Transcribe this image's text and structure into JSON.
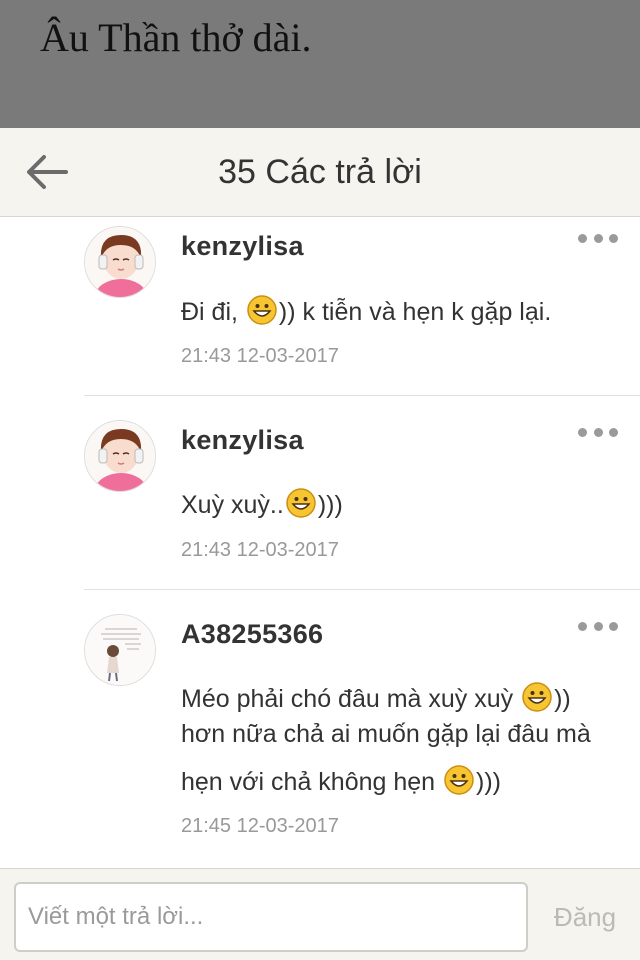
{
  "background": {
    "story_text": "Âu Thần thở dài."
  },
  "header": {
    "title": "35 Các trả lời",
    "back_icon": "arrow-left-icon"
  },
  "comments": [
    {
      "username": "kenzylisa",
      "text_parts": [
        "Đi đi, ",
        ")) k tiễn và hẹn k gặp lại."
      ],
      "timestamp": "21:43 12-03-2017",
      "avatar": "girl-with-headphones-avatar"
    },
    {
      "username": "kenzylisa",
      "text_parts": [
        "Xuỳ xuỳ..",
        ")))"
      ],
      "timestamp": "21:43 12-03-2017",
      "avatar": "girl-with-headphones-avatar"
    },
    {
      "username": "A38255366",
      "text_line1_parts": [
        "Méo phải chó đâu mà xuỳ xuỳ ",
        "))"
      ],
      "text_line2": "hơn nữa chả ai muốn gặp lại đâu mà",
      "text_line3_parts": [
        "hẹn với chả không hẹn ",
        ")))"
      ],
      "timestamp": "21:45 12-03-2017",
      "avatar": "illustrated-girl-avatar"
    }
  ],
  "reply": {
    "placeholder": "Viết một trả lời...",
    "post_label": "Đăng"
  },
  "colors": {
    "header_bg": "#f6f4ef",
    "backdrop": "#7a7a7a",
    "muted_text": "#999999",
    "emoji_face": "#f7c531"
  }
}
